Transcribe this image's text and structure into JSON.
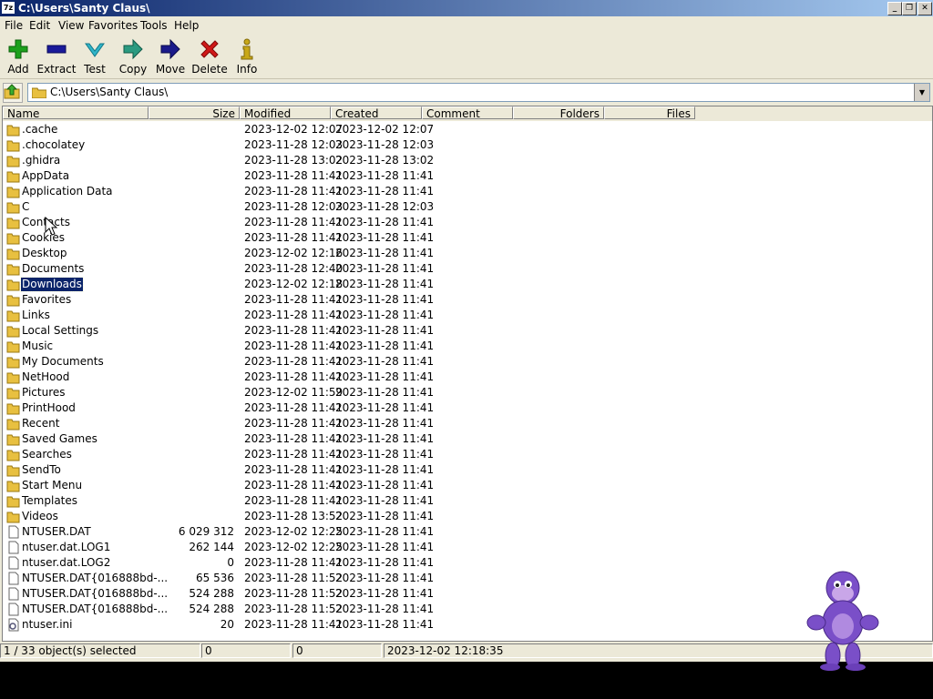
{
  "window": {
    "title": "C:\\Users\\Santy Claus\\",
    "app_icon_text": "7z",
    "controls": [
      "_",
      "❐",
      "✕"
    ]
  },
  "menu": [
    "File",
    "Edit",
    "View",
    "Favorites",
    "Tools",
    "Help"
  ],
  "toolbar": [
    {
      "label": "Add",
      "icon": "plus-icon",
      "color": "#1ca01c"
    },
    {
      "label": "Extract",
      "icon": "minus-icon",
      "color": "#1a1a9a"
    },
    {
      "label": "Test",
      "icon": "check-icon",
      "color": "#30b4c8"
    },
    {
      "label": "Copy",
      "icon": "copy-arrow-icon",
      "color": "#2a9a80"
    },
    {
      "label": "Move",
      "icon": "move-arrow-icon",
      "color": "#1a1a8a"
    },
    {
      "label": "Delete",
      "icon": "delete-x-icon",
      "color": "#d01818"
    },
    {
      "label": "Info",
      "icon": "info-icon",
      "color": "#c8a818"
    }
  ],
  "address": {
    "path": "C:\\Users\\Santy Claus\\"
  },
  "columns": [
    "Name",
    "Size",
    "Modified",
    "Created",
    "Comment",
    "Folders",
    "Files"
  ],
  "files": [
    {
      "name": ".cache",
      "type": "folder",
      "size": "",
      "modified": "2023-12-02 12:07",
      "created": "2023-12-02 12:07"
    },
    {
      "name": ".chocolatey",
      "type": "folder",
      "size": "",
      "modified": "2023-11-28 12:03",
      "created": "2023-11-28 12:03"
    },
    {
      "name": ".ghidra",
      "type": "folder",
      "size": "",
      "modified": "2023-11-28 13:02",
      "created": "2023-11-28 13:02"
    },
    {
      "name": "AppData",
      "type": "folder",
      "size": "",
      "modified": "2023-11-28 11:41",
      "created": "2023-11-28 11:41"
    },
    {
      "name": "Application Data",
      "type": "folder",
      "size": "",
      "modified": "2023-11-28 11:41",
      "created": "2023-11-28 11:41"
    },
    {
      "name": "C",
      "type": "folder",
      "size": "",
      "modified": "2023-11-28 12:03",
      "created": "2023-11-28 12:03"
    },
    {
      "name": "Contacts",
      "type": "folder",
      "size": "",
      "modified": "2023-11-28 11:41",
      "created": "2023-11-28 11:41"
    },
    {
      "name": "Cookies",
      "type": "folder",
      "size": "",
      "modified": "2023-11-28 11:41",
      "created": "2023-11-28 11:41"
    },
    {
      "name": "Desktop",
      "type": "folder",
      "size": "",
      "modified": "2023-12-02 12:16",
      "created": "2023-11-28 11:41"
    },
    {
      "name": "Documents",
      "type": "folder",
      "size": "",
      "modified": "2023-11-28 12:40",
      "created": "2023-11-28 11:41"
    },
    {
      "name": "Downloads",
      "type": "folder",
      "size": "",
      "modified": "2023-12-02 12:18",
      "created": "2023-11-28 11:41",
      "selected": true
    },
    {
      "name": "Favorites",
      "type": "folder",
      "size": "",
      "modified": "2023-11-28 11:41",
      "created": "2023-11-28 11:41"
    },
    {
      "name": "Links",
      "type": "folder",
      "size": "",
      "modified": "2023-11-28 11:41",
      "created": "2023-11-28 11:41"
    },
    {
      "name": "Local Settings",
      "type": "folder",
      "size": "",
      "modified": "2023-11-28 11:41",
      "created": "2023-11-28 11:41"
    },
    {
      "name": "Music",
      "type": "folder",
      "size": "",
      "modified": "2023-11-28 11:41",
      "created": "2023-11-28 11:41"
    },
    {
      "name": "My Documents",
      "type": "folder",
      "size": "",
      "modified": "2023-11-28 11:41",
      "created": "2023-11-28 11:41"
    },
    {
      "name": "NetHood",
      "type": "folder",
      "size": "",
      "modified": "2023-11-28 11:41",
      "created": "2023-11-28 11:41"
    },
    {
      "name": "Pictures",
      "type": "folder",
      "size": "",
      "modified": "2023-12-02 11:59",
      "created": "2023-11-28 11:41"
    },
    {
      "name": "PrintHood",
      "type": "folder",
      "size": "",
      "modified": "2023-11-28 11:41",
      "created": "2023-11-28 11:41"
    },
    {
      "name": "Recent",
      "type": "folder",
      "size": "",
      "modified": "2023-11-28 11:41",
      "created": "2023-11-28 11:41"
    },
    {
      "name": "Saved Games",
      "type": "folder",
      "size": "",
      "modified": "2023-11-28 11:41",
      "created": "2023-11-28 11:41"
    },
    {
      "name": "Searches",
      "type": "folder",
      "size": "",
      "modified": "2023-11-28 11:41",
      "created": "2023-11-28 11:41"
    },
    {
      "name": "SendTo",
      "type": "folder",
      "size": "",
      "modified": "2023-11-28 11:41",
      "created": "2023-11-28 11:41"
    },
    {
      "name": "Start Menu",
      "type": "folder",
      "size": "",
      "modified": "2023-11-28 11:41",
      "created": "2023-11-28 11:41"
    },
    {
      "name": "Templates",
      "type": "folder",
      "size": "",
      "modified": "2023-11-28 11:41",
      "created": "2023-11-28 11:41"
    },
    {
      "name": "Videos",
      "type": "folder",
      "size": "",
      "modified": "2023-11-28 13:52",
      "created": "2023-11-28 11:41"
    },
    {
      "name": "NTUSER.DAT",
      "type": "file",
      "size": "6 029 312",
      "modified": "2023-12-02 12:25",
      "created": "2023-11-28 11:41"
    },
    {
      "name": "ntuser.dat.LOG1",
      "type": "file",
      "size": "262 144",
      "modified": "2023-12-02 12:25",
      "created": "2023-11-28 11:41"
    },
    {
      "name": "ntuser.dat.LOG2",
      "type": "file",
      "size": "0",
      "modified": "2023-11-28 11:41",
      "created": "2023-11-28 11:41"
    },
    {
      "name": "NTUSER.DAT{016888bd-...",
      "type": "file",
      "size": "65 536",
      "modified": "2023-11-28 11:52",
      "created": "2023-11-28 11:41"
    },
    {
      "name": "NTUSER.DAT{016888bd-...",
      "type": "file",
      "size": "524 288",
      "modified": "2023-11-28 11:52",
      "created": "2023-11-28 11:41"
    },
    {
      "name": "NTUSER.DAT{016888bd-...",
      "type": "file",
      "size": "524 288",
      "modified": "2023-11-28 11:52",
      "created": "2023-11-28 11:41"
    },
    {
      "name": "ntuser.ini",
      "type": "ini",
      "size": "20",
      "modified": "2023-11-28 11:41",
      "created": "2023-11-28 11:41"
    }
  ],
  "status": {
    "selected": "1 / 33 object(s) selected",
    "size": "0",
    "packed": "0",
    "datetime": "2023-12-02 12:18:35"
  }
}
